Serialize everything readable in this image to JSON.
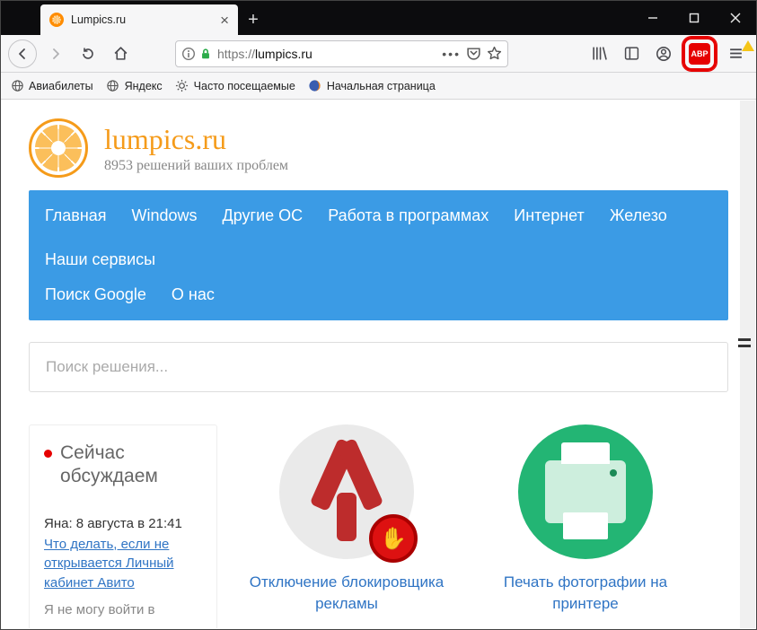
{
  "window": {
    "tab_title": "Lumpics.ru",
    "url_proto": "https://",
    "url_host": "lumpics.ru"
  },
  "bookmarks": {
    "items": [
      {
        "label": "Авиабилеты"
      },
      {
        "label": "Яндекс"
      },
      {
        "label": "Часто посещаемые"
      },
      {
        "label": "Начальная страница"
      }
    ]
  },
  "abp_label": "ABP",
  "site": {
    "title": "lumpics.ru",
    "tagline": "8953 решений ваших проблем"
  },
  "nav_items": [
    "Главная",
    "Windows",
    "Другие ОС",
    "Работа в программах",
    "Интернет",
    "Железо",
    "Наши сервисы",
    "Поиск Google",
    "О нас"
  ],
  "search_placeholder": "Поиск решения...",
  "discuss": {
    "title": "Сейчас обсуждаем",
    "meta": "Яна: 8 августа в 21:41",
    "link": "Что делать, если не открывается Личный кабинет Авито",
    "text": "Я не могу войти в"
  },
  "cards": [
    {
      "label": "Отключение блокировщика рекламы"
    },
    {
      "label": "Печать фотографии на принтере"
    }
  ]
}
